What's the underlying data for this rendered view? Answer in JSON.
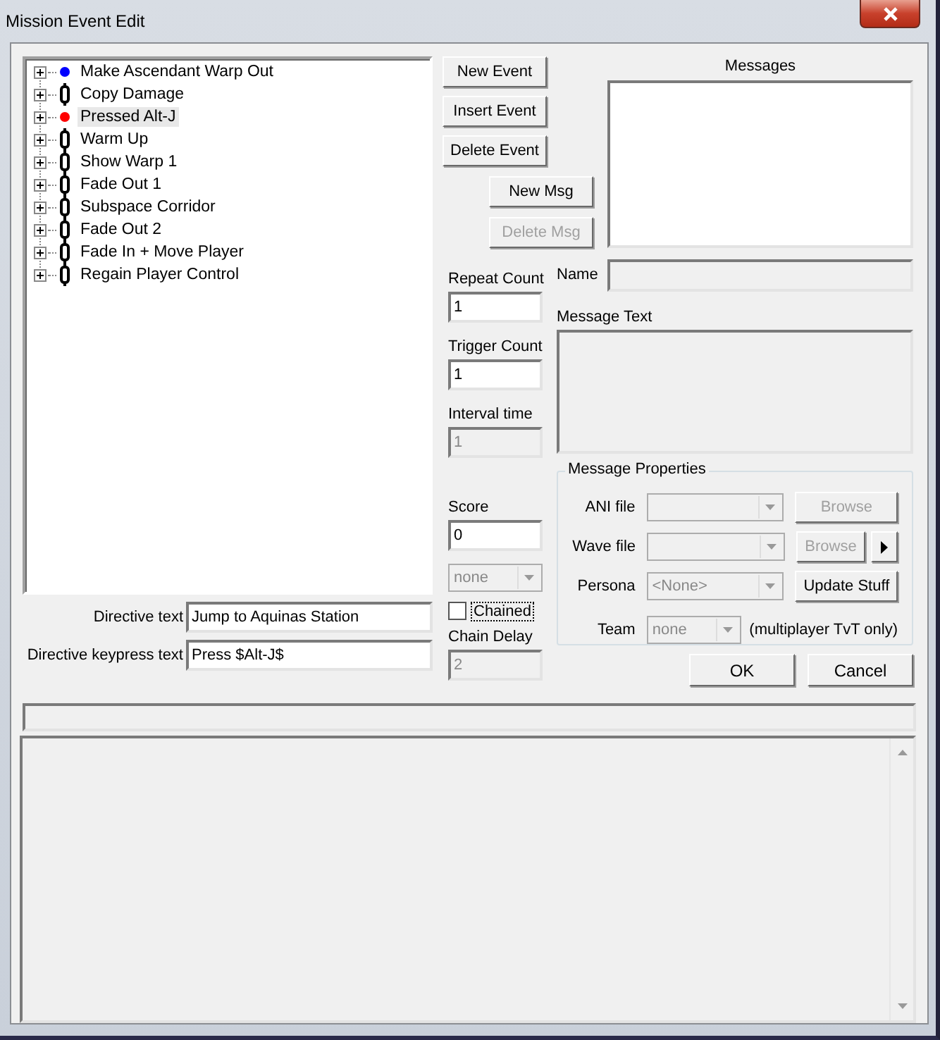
{
  "window": {
    "title": "Mission Event Edit"
  },
  "events": [
    {
      "label": "Make Ascendant Warp Out",
      "kind": "dot",
      "color": "#0000ff",
      "selected": false
    },
    {
      "label": "Copy Damage",
      "kind": "chain",
      "selected": false
    },
    {
      "label": "Pressed Alt-J",
      "kind": "dot",
      "color": "#ff0000",
      "selected": true
    },
    {
      "label": "Warm Up",
      "kind": "chain",
      "selected": false
    },
    {
      "label": "Show Warp 1",
      "kind": "chain",
      "selected": false
    },
    {
      "label": "Fade Out 1",
      "kind": "chain",
      "selected": false
    },
    {
      "label": "Subspace Corridor",
      "kind": "chain",
      "selected": false
    },
    {
      "label": "Fade Out 2",
      "kind": "chain",
      "selected": false
    },
    {
      "label": "Fade In + Move Player",
      "kind": "chain",
      "selected": false
    },
    {
      "label": "Regain Player Control",
      "kind": "chain",
      "selected": false
    }
  ],
  "directive_fields": [
    {
      "label": "Directive text",
      "value": "Jump to Aquinas Station"
    },
    {
      "label": "Directive keypress text",
      "value": "Press $Alt-J$"
    }
  ],
  "event_buttons": [
    {
      "label": "New Event",
      "disabled": false
    },
    {
      "label": "Insert Event",
      "disabled": false
    },
    {
      "label": "Delete Event",
      "disabled": false
    }
  ],
  "message_buttons": [
    {
      "label": "New Msg",
      "disabled": false
    },
    {
      "label": "Delete Msg",
      "disabled": true
    }
  ],
  "messages": {
    "label": "Messages"
  },
  "event_fields": [
    {
      "label": "Repeat Count",
      "value": "1",
      "disabled": false
    },
    {
      "label": "Trigger Count",
      "value": "1",
      "disabled": false
    },
    {
      "label": "Interval time",
      "value": "1",
      "disabled": true
    },
    {
      "label": "Score",
      "value": "0",
      "disabled": false
    }
  ],
  "score_team": {
    "value": "none",
    "disabled": true
  },
  "chained": {
    "label": "Chained",
    "checked": false
  },
  "chain_delay": {
    "label": "Chain Delay",
    "value": "2",
    "disabled": true
  },
  "message": {
    "name_label": "Name",
    "text_label": "Message Text",
    "disabled": true
  },
  "message_properties": {
    "title": "Message Properties",
    "rows": [
      {
        "kind": "file",
        "label": "ANI file",
        "disabled": true,
        "button": {
          "label": "Browse",
          "disabled": true
        }
      },
      {
        "kind": "file_play",
        "label": "Wave file",
        "disabled": true,
        "button": {
          "label": "Browse",
          "disabled": true
        }
      },
      {
        "kind": "file",
        "label": "Persona",
        "value": "<None>",
        "disabled": true,
        "button": {
          "label": "Update Stuff",
          "disabled": false
        }
      },
      {
        "kind": "team",
        "label": "Team",
        "value": "none",
        "disabled": true,
        "note": "(multiplayer TvT only)"
      }
    ]
  },
  "dialog_buttons": [
    {
      "label": "OK"
    },
    {
      "label": "Cancel"
    }
  ]
}
